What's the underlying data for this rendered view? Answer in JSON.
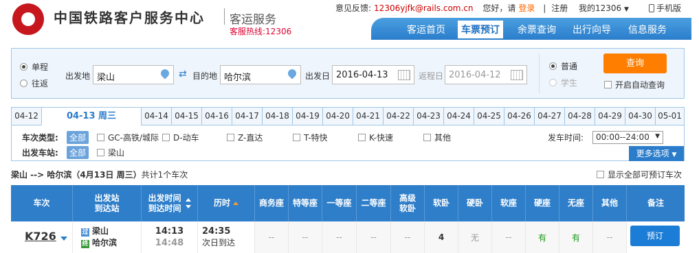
{
  "header": {
    "brand": "中国铁路客户服务中心",
    "service": "客运服务",
    "hotline": "客服热线:12306",
    "feedback_label": "意见反馈:",
    "feedback_email": "12306yjfk@rails.com.cn",
    "greeting": "您好，请",
    "login": "登录",
    "sep": "|",
    "register": "注册",
    "my_account": "我的12306",
    "mobile": "手机版"
  },
  "nav": [
    "客运首页",
    "车票预订",
    "余票查询",
    "出行向导",
    "信息服务"
  ],
  "search": {
    "trip_oneway": "单程",
    "trip_round": "往返",
    "from_label": "出发地",
    "from_value": "梁山",
    "to_label": "目的地",
    "to_value": "哈尔滨",
    "date_label": "出发日",
    "date_value": "2016-04-13",
    "return_label": "返程日",
    "return_value": "2016-04-12",
    "type_normal": "普通",
    "type_student": "学生",
    "query_button": "查询",
    "auto_query": "开启自动查询"
  },
  "dates": [
    "04-12",
    "04-13 周三",
    "04-14",
    "04-15",
    "04-16",
    "04-17",
    "04-18",
    "04-19",
    "04-20",
    "04-21",
    "04-22",
    "04-23",
    "04-24",
    "04-25",
    "04-26",
    "04-27",
    "04-28",
    "04-29",
    "04-30",
    "05-01"
  ],
  "filter": {
    "type_label": "车次类型:",
    "all": "全部",
    "types": [
      "GC-高铁/城际",
      "D-动车",
      "Z-直达",
      "T-特快",
      "K-快速",
      "其他"
    ],
    "station_label": "出发车站:",
    "station": "梁山",
    "time_label": "发车时间:",
    "time_value": "00:00--24:00",
    "time_arrow": "▼",
    "more": "更多选项"
  },
  "summary": {
    "route": "梁山 --> 哈尔滨（4月13日 周三）",
    "count": "共计1个车次",
    "show_all": "显示全部可预订车次"
  },
  "table": {
    "headers": [
      "车次",
      "出发站\n到达站",
      "出发时间\n到达时间",
      "历时",
      "商务座",
      "特等座",
      "一等座",
      "二等座",
      "高级\n软卧",
      "软卧",
      "硬卧",
      "软座",
      "硬座",
      "无座",
      "其他",
      "备注"
    ],
    "row": {
      "train": "K726",
      "from_badge": "过",
      "from": "梁山",
      "to_badge": "终",
      "to": "哈尔滨",
      "depart": "14:13",
      "arrive": "14:48",
      "duration": "24:35",
      "arrival_note": "次日到达",
      "seats": [
        "--",
        "--",
        "--",
        "--",
        "--",
        "4",
        "无",
        "--",
        "有",
        "有",
        "--"
      ],
      "book": "预订"
    }
  },
  "colors": {
    "brand_red": "#c7171e",
    "nav_blue": "#2b7dcb",
    "query_orange": "#ff7e00",
    "available_green": "#1c9a1c"
  }
}
